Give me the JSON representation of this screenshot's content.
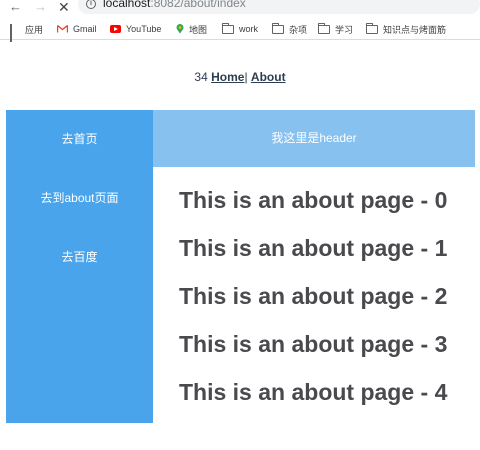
{
  "browser": {
    "url_host": "localhost",
    "url_rest": ":8082/about/index",
    "bookmarks": [
      {
        "label": "应用",
        "icon": "apps-icon"
      },
      {
        "label": "Gmail",
        "icon": "gmail-icon"
      },
      {
        "label": "YouTube",
        "icon": "youtube-icon"
      },
      {
        "label": "地图",
        "icon": "maps-icon"
      },
      {
        "label": "work",
        "icon": "folder-icon"
      },
      {
        "label": "杂项",
        "icon": "folder-icon"
      },
      {
        "label": "学习",
        "icon": "folder-icon"
      },
      {
        "label": "知识点与烤面筋",
        "icon": "folder-icon"
      }
    ]
  },
  "topnav": {
    "count": "34",
    "home_label": "Home",
    "separator": "|",
    "about_label": "About"
  },
  "sidebar": {
    "items": [
      {
        "label": "去首页"
      },
      {
        "label": "去到about页面"
      },
      {
        "label": "去百度"
      }
    ]
  },
  "header": {
    "text": "我这里是header"
  },
  "main": {
    "lines": [
      "This is an about page - 0",
      "This is an about page - 1",
      "This is an about page - 2",
      "This is an about page - 3",
      "This is an about page - 4"
    ]
  },
  "colors": {
    "sidebar_bg": "#49a4ec",
    "header_bg": "#86c1f0",
    "text_dark": "#2c3e50"
  }
}
